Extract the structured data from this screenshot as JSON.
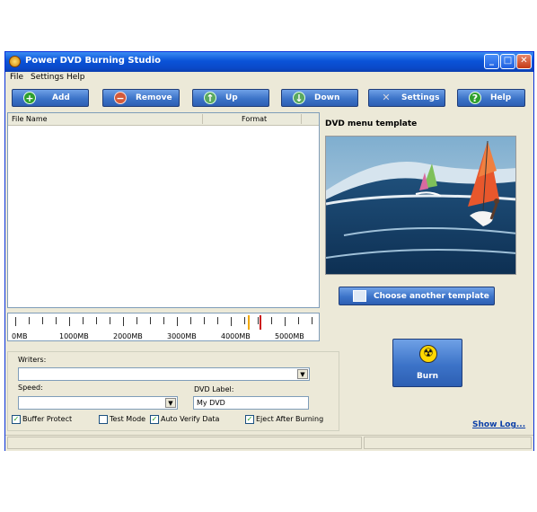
{
  "window": {
    "title": "Power DVD Burning Studio"
  },
  "menu": [
    {
      "label": "File"
    },
    {
      "label": "Settings"
    },
    {
      "label": "Help"
    }
  ],
  "toolbar": [
    {
      "label": "Add",
      "icon": "plus-icon"
    },
    {
      "label": "Remove",
      "icon": "minus-icon"
    },
    {
      "label": "Up",
      "icon": "arrow-up-icon"
    },
    {
      "label": "Down",
      "icon": "arrow-down-icon"
    },
    {
      "label": "Settings",
      "icon": "tools-icon"
    },
    {
      "label": "Help",
      "icon": "help-icon"
    }
  ],
  "filelist": {
    "columns": [
      "File Name",
      "Format"
    ],
    "rows": []
  },
  "template": {
    "label": "DVD menu template",
    "choose_label": "Choose another template"
  },
  "capacity": {
    "labels": [
      "0MB",
      "1000MB",
      "2000MB",
      "3000MB",
      "4000MB",
      "5000MB"
    ]
  },
  "writers": {
    "label": "Writers:",
    "value": ""
  },
  "speed": {
    "label": "Speed:",
    "value": ""
  },
  "dvd_label": {
    "label": "DVD Label:",
    "value": "My DVD"
  },
  "options": [
    {
      "label": "Buffer Protect",
      "checked": true
    },
    {
      "label": "Test Mode",
      "checked": false
    },
    {
      "label": "Auto Verify Data",
      "checked": true
    },
    {
      "label": "Eject After Burning",
      "checked": true
    }
  ],
  "burn": {
    "label": "Burn"
  },
  "show_log": "Show Log...",
  "colors": {
    "accent": "#3c73c8",
    "titlebar": "#0a53d8"
  }
}
